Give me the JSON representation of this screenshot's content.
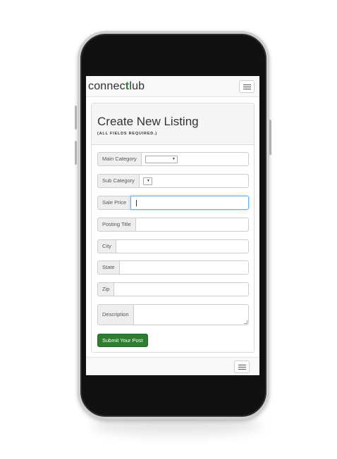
{
  "brand": {
    "prefix": "connec",
    "mark": "t",
    "suffix": "lub"
  },
  "page": {
    "title": "Create New Listing",
    "subtitle": "(ALL FIELDS REQUIRED.)"
  },
  "form": {
    "main_category": {
      "label": "Main Category",
      "value": ""
    },
    "sub_category": {
      "label": "Sub Category",
      "value": ""
    },
    "sale_price": {
      "label": "Sale Price",
      "value": ""
    },
    "posting_title": {
      "label": "Posting Title",
      "value": ""
    },
    "city": {
      "label": "City",
      "value": ""
    },
    "state": {
      "label": "State",
      "value": ""
    },
    "zip": {
      "label": "Zip",
      "value": ""
    },
    "description": {
      "label": "Description",
      "value": ""
    },
    "submit_label": "Submit Your Post"
  },
  "icons": {
    "menu": "hamburger-menu-icon",
    "dropdown": "chevron-down-icon"
  },
  "colors": {
    "accent_green": "#2f7d32",
    "focus_blue": "#66afe9",
    "navbar_bg": "#f8f8f8"
  }
}
